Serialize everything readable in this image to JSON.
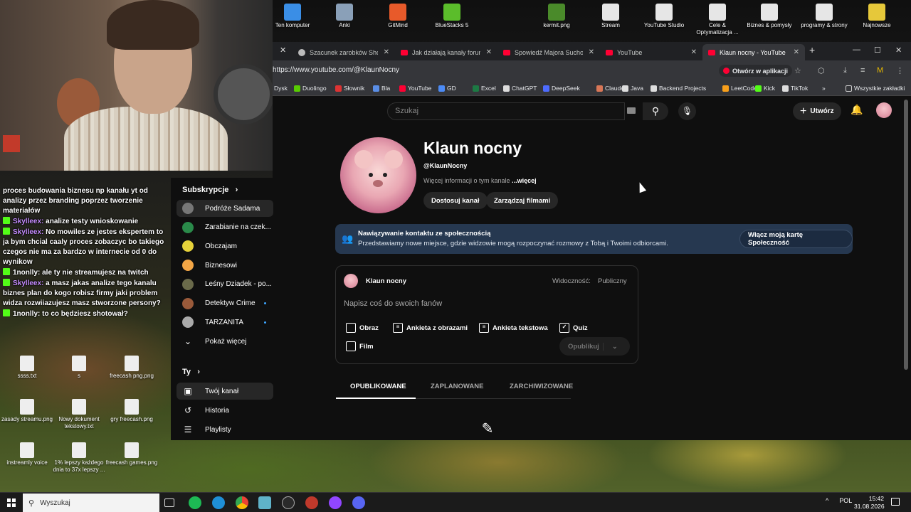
{
  "desktop_icons_top": [
    {
      "label": "Ten komputer",
      "color": "#3a8ee6"
    },
    {
      "label": "Anki",
      "color": "#8aa0b8"
    },
    {
      "label": "GitMind",
      "color": "#e85a2a"
    },
    {
      "label": "BlueStacks 5",
      "color": "#5bbd2b"
    },
    {
      "label": "kermit.png",
      "color": "#4a8a2a"
    },
    {
      "label": "Stream",
      "color": "#e6e6e6"
    },
    {
      "label": "YouTube Studio",
      "color": "#e6e6e6"
    },
    {
      "label": "Cele & Optymalizacja ...",
      "color": "#e6e6e6"
    },
    {
      "label": "Biznes & pomysły",
      "color": "#e6e6e6"
    },
    {
      "label": "programy & strony",
      "color": "#e6e6e6"
    },
    {
      "label": "Najnowsze",
      "color": "#e6c83a"
    }
  ],
  "chat": [
    {
      "user": "",
      "text": "proces budowania biznesu np kanału yt od analizy przez branding poprzez tworzenie materiałów",
      "user_color": "white"
    },
    {
      "user": "Skylleex:",
      "text": "analize testy wnioskowanie",
      "user_color": "purple"
    },
    {
      "user": "Skylleex:",
      "text": "No mowiles ze jestes ekspertem to ja bym chcial caaly proces zobaczyc bo takiego czegos nie ma za bardzo w internecie od 0 do wynikow",
      "user_color": "purple"
    },
    {
      "user": "1nonlly:",
      "text": "ale ty nie streamujesz na twitch",
      "user_color": "white"
    },
    {
      "user": "Skylleex:",
      "text": "a masz jakas analize tego kanalu biznes plan do kogo robisz firmy jaki problem widza rozwiiazujesz masz stworzone persony?",
      "user_color": "purple"
    },
    {
      "user": "1nonlly:",
      "text": "to co będziesz shotował?",
      "user_color": "white"
    }
  ],
  "desktop_icons_low": [
    {
      "label": "ssss.txt"
    },
    {
      "label": "s"
    },
    {
      "label": "freecash png.png"
    },
    {
      "label": "zasady streamu.png"
    },
    {
      "label": "Nowy dokument tekstowy.txt"
    },
    {
      "label": "gry freecash.png"
    },
    {
      "label": "instreamly voice"
    },
    {
      "label": "1% lepszy każdego dnia to 37x lepszy ..."
    },
    {
      "label": "freecash games.png"
    }
  ],
  "tabs": [
    {
      "label": "Szacunek zarobków Shorts",
      "fav": "gray"
    },
    {
      "label": "Jak działają kanały forum n",
      "fav": "red"
    },
    {
      "label": "Spowiedź Majora Suchodo",
      "fav": "red"
    },
    {
      "label": "YouTube",
      "fav": "red"
    },
    {
      "label": "Klaun nocny - YouTube",
      "fav": "red",
      "active": true
    }
  ],
  "address": {
    "url": "https://www.youtube.com/@KlaunNocny",
    "open_in_app": "Otwórz w aplikacji"
  },
  "bookmarks": [
    {
      "label": "Dysk",
      "color": "#4c8bf5"
    },
    {
      "label": "Duolingo",
      "color": "#58cc02"
    },
    {
      "label": "Słownik",
      "color": "#d33"
    },
    {
      "label": "Bla",
      "color": "#5a8ee6"
    },
    {
      "label": "YouTube",
      "color": "#ff0033"
    },
    {
      "label": "GD",
      "color": "#4c8bf5"
    },
    {
      "label": "Excel",
      "color": "#1d7a44"
    },
    {
      "label": "ChatGPT",
      "color": "#ddd"
    },
    {
      "label": "DeepSeek",
      "color": "#4d6bfe"
    },
    {
      "label": "Claude",
      "color": "#d97757"
    },
    {
      "label": "Java",
      "color": "#ddd"
    },
    {
      "label": "Backend Projects",
      "color": "#ddd"
    },
    {
      "label": "LeetCode",
      "color": "#f89f1b"
    },
    {
      "label": "Kick",
      "color": "#53fc18"
    },
    {
      "label": "TikTok",
      "color": "#ddd"
    }
  ],
  "bookmarks_all": "Wszystkie zakładki",
  "yt": {
    "search_placeholder": "Szukaj",
    "create_label": "Utwórz",
    "nav": {
      "subs_header": "Subskrypcje",
      "subs": [
        {
          "label": "Podróże Sadama",
          "color": "#777",
          "dot": false,
          "selected": true
        },
        {
          "label": "Zarabianie na czek...",
          "color": "#2a8a4a",
          "dot": false
        },
        {
          "label": "Obczajam",
          "color": "#e6d23a",
          "dot": false
        },
        {
          "label": "Biznesowi",
          "color": "#f3a646",
          "dot": false
        },
        {
          "label": "Leśny Dziadek - po...",
          "color": "#6a6a4a",
          "dot": false
        },
        {
          "label": "Detektyw Crime",
          "color": "#9a5a3a",
          "dot": true
        },
        {
          "label": "TARZANITA",
          "color": "#aaa",
          "dot": true
        }
      ],
      "show_more": "Pokaż więcej",
      "you_header": "Ty",
      "you": [
        {
          "label": "Twój kanał",
          "icon": "channel-icon",
          "glyph": "▣",
          "selected": true
        },
        {
          "label": "Historia",
          "icon": "history-icon",
          "glyph": "↺"
        },
        {
          "label": "Playlisty",
          "icon": "playlists-icon",
          "glyph": "☰"
        }
      ]
    },
    "channel": {
      "name": "Klaun nocny",
      "handle": "@KlaunNocny",
      "more_info": "Więcej informacji o tym kanale",
      "more_link": "...więcej",
      "customize": "Dostosuj kanał",
      "manage": "Zarządzaj filmami"
    },
    "banner": {
      "title": "Nawiązywanie kontaktu ze społecznością",
      "text": "Przedstawiamy nowe miejsce, gdzie widzowie mogą rozpoczynać rozmowy z Tobą i Twoimi odbiorcami.",
      "button": "Włącz moją kartę Społeczność"
    },
    "composer": {
      "author": "Klaun nocny",
      "visibility_label": "Widoczność:",
      "visibility_value": "Publiczny",
      "placeholder": "Napisz coś do swoich fanów",
      "types": [
        "Obraz",
        "Ankieta z obrazami",
        "Ankieta tekstowa",
        "Quiz",
        "Film"
      ],
      "publish": "Opublikuj"
    },
    "content_tabs": [
      "OPUBLIKOWANE",
      "ZAPLANOWANE",
      "ZARCHIWIZOWANE"
    ]
  },
  "taskbar": {
    "search": "Wyszukaj",
    "lang": "POL",
    "time": "15:42",
    "date": "31.08.2026"
  }
}
